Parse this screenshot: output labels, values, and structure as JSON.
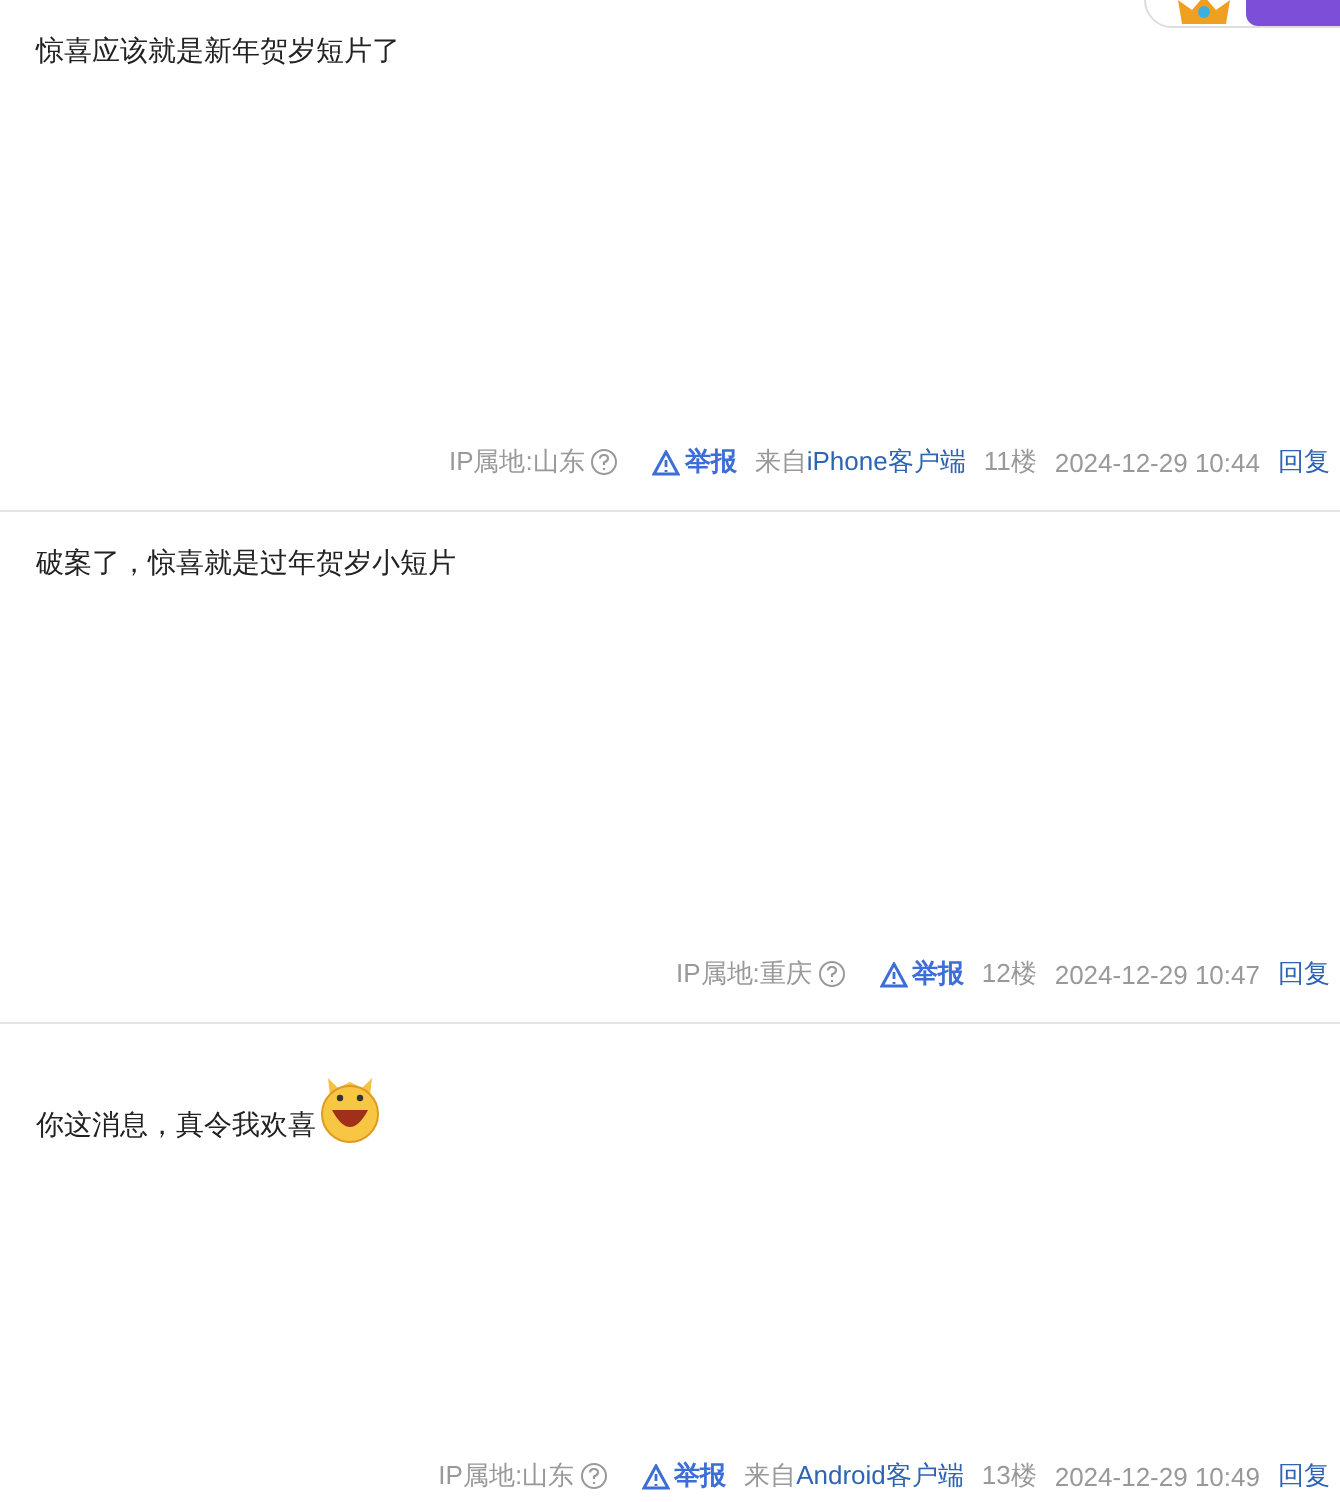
{
  "posts": [
    {
      "text": "惊喜应该就是新年贺岁短片了",
      "emoji": false,
      "ip": "IP属地:山东",
      "report": "举报",
      "client_prefix": "来自",
      "client": "iPhone客户端",
      "floor": "11楼",
      "time": "2024-12-29 10:44",
      "reply": "回复"
    },
    {
      "text": "破案了，惊喜就是过年贺岁小短片",
      "emoji": false,
      "ip": "IP属地:重庆",
      "report": "举报",
      "floor": "12楼",
      "time": "2024-12-29 10:47",
      "reply": "回复"
    },
    {
      "text": "你这消息，真令我欢喜",
      "emoji": true,
      "ip": "IP属地:山东",
      "report": "举报",
      "client_prefix": "来自",
      "client": "Android客户端",
      "floor": "13楼",
      "time": "2024-12-29 10:49",
      "reply": "回复"
    }
  ]
}
